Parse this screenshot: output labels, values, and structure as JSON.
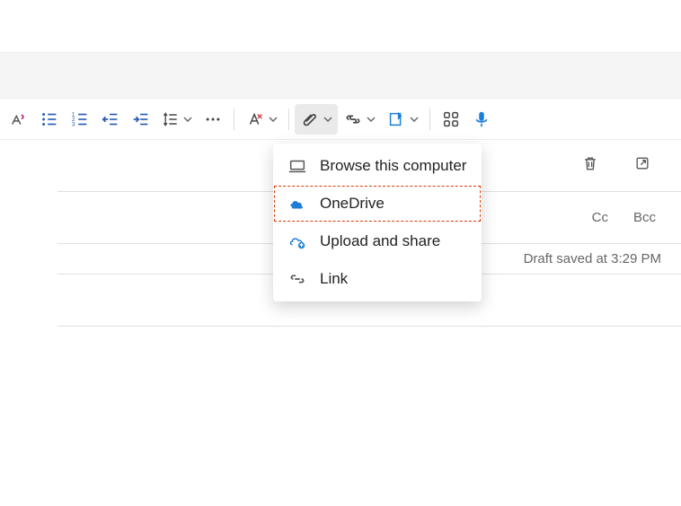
{
  "toolbar": {
    "items": [
      {
        "name": "clear-formatting"
      },
      {
        "name": "bulleted-list"
      },
      {
        "name": "numbered-list"
      },
      {
        "name": "decrease-indent"
      },
      {
        "name": "increase-indent"
      },
      {
        "name": "line-spacing",
        "chevron": true
      },
      {
        "name": "more-options"
      },
      {
        "sep": true
      },
      {
        "name": "text-style",
        "chevron": true
      },
      {
        "sep": true
      },
      {
        "name": "attach",
        "chevron": true,
        "active": true
      },
      {
        "name": "insert-link",
        "chevron": true
      },
      {
        "name": "signature",
        "chevron": true
      },
      {
        "sep": true
      },
      {
        "name": "apps"
      },
      {
        "name": "dictate"
      }
    ]
  },
  "compose": {
    "actions": {
      "discard": "discard-icon",
      "popout": "popout-icon"
    },
    "recipients": {
      "cc": "Cc",
      "bcc": "Bcc"
    },
    "status": "Draft saved at 3:29 PM"
  },
  "attach_menu": {
    "items": [
      {
        "icon": "laptop-icon",
        "label": "Browse this computer"
      },
      {
        "icon": "onedrive-icon",
        "label": "OneDrive",
        "highlighted": true
      },
      {
        "icon": "upload-share-icon",
        "label": "Upload and share"
      },
      {
        "icon": "link-icon",
        "label": "Link"
      }
    ]
  }
}
